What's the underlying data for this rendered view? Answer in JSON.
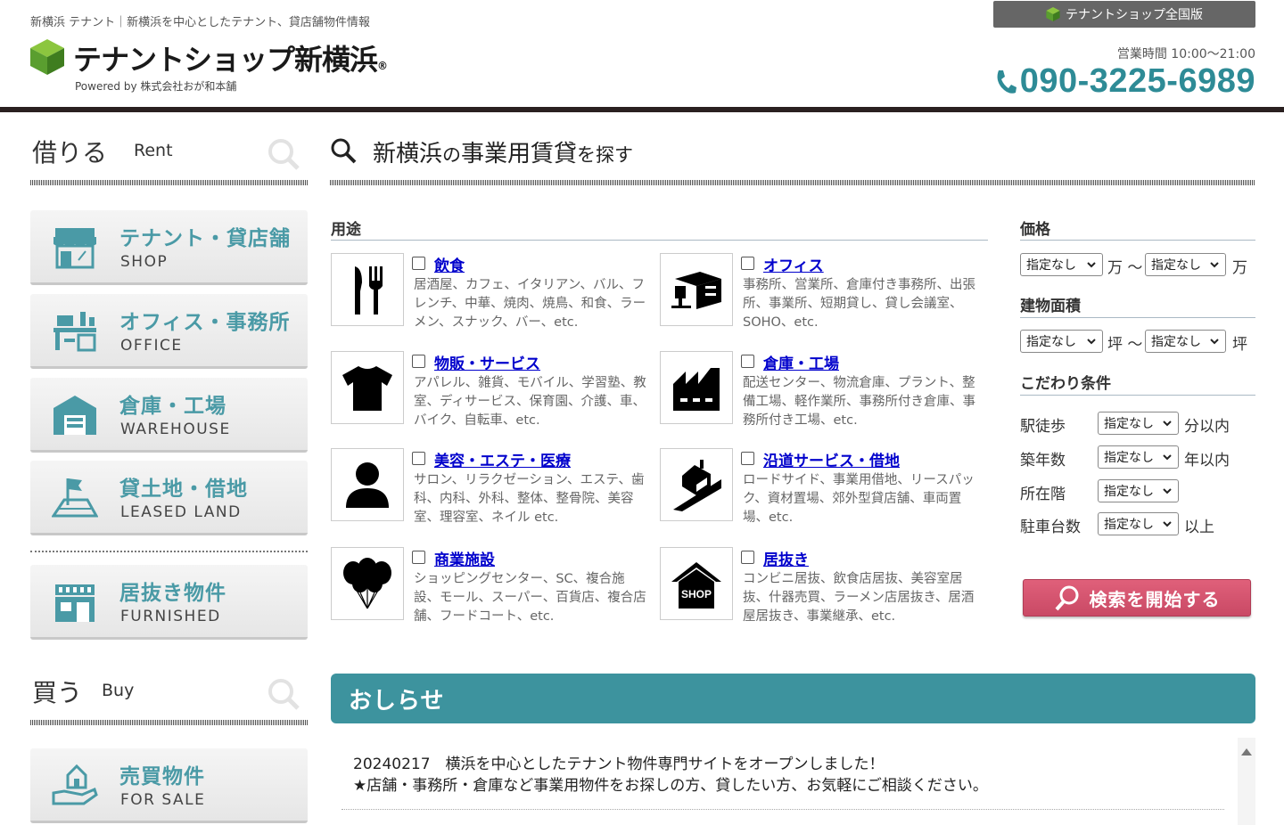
{
  "header": {
    "tagline": "新横浜 テナント｜新横浜を中心としたテナント、貸店舗物件情報",
    "logo_title": "テナントショップ新横浜",
    "logo_reg": "®",
    "logo_sub": "Powered by  株式会社おが和本舗",
    "national_button": "テナントショップ全国版",
    "hours": "営業時間 10:00〜21:00",
    "phone": "090-3225-6989"
  },
  "sidebar": {
    "rent_heading": {
      "jp": "借りる",
      "en": "Rent"
    },
    "rent_items": [
      {
        "jp": "テナント・貸店舗",
        "en": "SHOP",
        "icon": "shop-icon"
      },
      {
        "jp": "オフィス・事務所",
        "en": "OFFICE",
        "icon": "office-icon"
      },
      {
        "jp": "倉庫・工場",
        "en": "WAREHOUSE",
        "icon": "warehouse-icon"
      },
      {
        "jp": "貸土地・借地",
        "en": "LEASED LAND",
        "icon": "land-icon"
      },
      {
        "jp": "居抜き物件",
        "en": "FURNISHED",
        "icon": "furnished-icon"
      }
    ],
    "buy_heading": {
      "jp": "買う",
      "en": "Buy"
    },
    "buy_items": [
      {
        "jp": "売買物件",
        "en": "FOR SALE",
        "icon": "for-sale-icon"
      }
    ]
  },
  "main": {
    "heading": {
      "a": "新横浜",
      "b": "の",
      "c": "事業用賃貸",
      "d": "を探す"
    },
    "usage_title": "用途",
    "usages": [
      {
        "label": "飲食",
        "desc": "居酒屋、カフェ、イタリアン、バル、フレンチ、中華、焼肉、焼鳥、和食、ラーメン、スナック、バー、etc.",
        "icon": "restaurant-icon"
      },
      {
        "label": "オフィス",
        "desc": "事務所、営業所、倉庫付き事務所、出張所、事業所、短期貸し、貸し会議室、SOHO、etc.",
        "icon": "office-desk-icon"
      },
      {
        "label": "物販・サービス",
        "desc": "アパレル、雑貨、モバイル、学習塾、教室、ディサービス、保育園、介護、車、バイク、自転車、etc.",
        "icon": "tshirt-icon"
      },
      {
        "label": "倉庫・工場",
        "desc": "配送センター、物流倉庫、プラント、整備工場、軽作業所、事務所付き倉庫、事務所付き工場、etc.",
        "icon": "factory-icon"
      },
      {
        "label": "美容・エステ・医療",
        "desc": "サロン、リラクゼーション、エステ、歯科、内科、外科、整体、整骨院、美容室、理容室、ネイル etc.",
        "icon": "person-icon"
      },
      {
        "label": "沿道サービス・借地",
        "desc": "ロードサイド、事業用借地、リースパック、資材置場、郊外型貸店舗、車両置場、etc.",
        "icon": "roadside-icon"
      },
      {
        "label": "商業施設",
        "desc": "ショッピングセンター、SC、複合施設、モール、スーパー、百貨店、複合店舗、フードコート、etc.",
        "icon": "balloons-icon"
      },
      {
        "label": "居抜き",
        "desc": "コンビニ居抜、飲食店居抜、美容室居抜、什器売買、ラーメン店居抜き、居酒屋居抜き、事業継承、etc.",
        "icon": "shop-house-icon"
      }
    ],
    "price": {
      "title": "価格",
      "min": "指定なし",
      "max": "指定なし",
      "unit1": "万 〜",
      "unit2": "万"
    },
    "area": {
      "title": "建物面積",
      "min": "指定なし",
      "max": "指定なし",
      "unit1": "坪 〜",
      "unit2": "坪"
    },
    "conditions": {
      "title": "こだわり条件",
      "rows": [
        {
          "label": "駅徒歩",
          "value": "指定なし",
          "unit": "分以内"
        },
        {
          "label": "築年数",
          "value": "指定なし",
          "unit": "年以内"
        },
        {
          "label": "所在階",
          "value": "指定なし",
          "unit": ""
        },
        {
          "label": "駐車台数",
          "value": "指定なし",
          "unit": "以上"
        }
      ]
    },
    "search_button": "検索を開始する"
  },
  "news": {
    "title": "おしらせ",
    "lines": [
      "20240217　横浜を中心としたテナント物件専門サイトをオープンしました！",
      "★店舗・事務所・倉庫など事業用物件をお探しの方、貸したい方、お気軽にご相談ください。"
    ]
  },
  "colors": {
    "accent_teal": "#3d939e",
    "phone": "#2e8b96",
    "sidebar_label": "#4a9aa6",
    "search_button": "#d4556f",
    "link": "#0000cc"
  }
}
